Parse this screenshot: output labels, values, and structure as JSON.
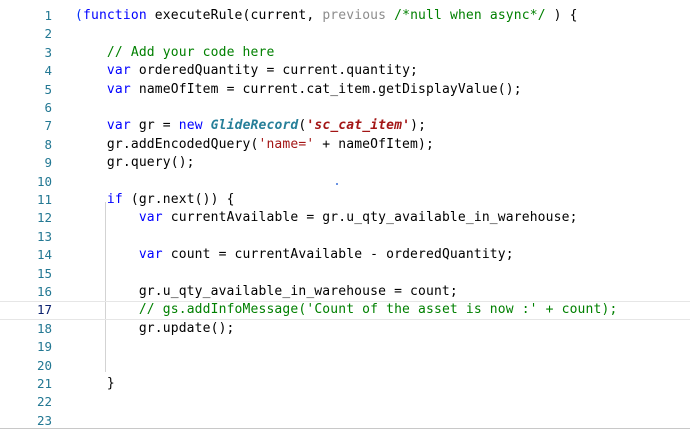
{
  "editor": {
    "active_line": 17,
    "line_numbers": [
      "1",
      "2",
      "3",
      "4",
      "5",
      "6",
      "7",
      "8",
      "9",
      "10",
      "11",
      "12",
      "13",
      "14",
      "15",
      "16",
      "17",
      "18",
      "19",
      "20",
      "21",
      "22",
      "23"
    ],
    "lines": [
      {
        "n": "1",
        "tokens": [
          {
            "t": "(",
            "c": "br1"
          },
          {
            "t": "function",
            "c": "kw"
          },
          {
            "t": " executeRule(current, "
          },
          {
            "t": "previous",
            "c": "prm"
          },
          {
            "t": " "
          },
          {
            "t": "/*null when async*/",
            "c": "cm"
          },
          {
            "t": " ) {"
          }
        ]
      },
      {
        "n": "2",
        "tokens": []
      },
      {
        "n": "3",
        "tokens": [
          {
            "t": "    "
          },
          {
            "t": "// Add your code here",
            "c": "cm"
          }
        ]
      },
      {
        "n": "4",
        "tokens": [
          {
            "t": "    "
          },
          {
            "t": "var",
            "c": "kw"
          },
          {
            "t": " orderedQuantity = current.quantity;"
          }
        ]
      },
      {
        "n": "5",
        "tokens": [
          {
            "t": "    "
          },
          {
            "t": "var",
            "c": "kw"
          },
          {
            "t": " nameOfItem = current.cat_item.getDisplayValue();"
          }
        ]
      },
      {
        "n": "6",
        "tokens": []
      },
      {
        "n": "7",
        "tokens": [
          {
            "t": "    "
          },
          {
            "t": "var",
            "c": "kw"
          },
          {
            "t": " gr = "
          },
          {
            "t": "new",
            "c": "kw"
          },
          {
            "t": " "
          },
          {
            "t": "GlideRecord",
            "c": "cls"
          },
          {
            "t": "("
          },
          {
            "t": "'sc_cat_item'",
            "c": "str-it"
          },
          {
            "t": ");"
          }
        ]
      },
      {
        "n": "8",
        "tokens": [
          {
            "t": "    gr.addEncodedQuery("
          },
          {
            "t": "'name='",
            "c": "str"
          },
          {
            "t": " + nameOfItem);"
          }
        ]
      },
      {
        "n": "9",
        "tokens": [
          {
            "t": "    gr.query();"
          }
        ]
      },
      {
        "n": "10",
        "tokens": []
      },
      {
        "n": "11",
        "tokens": [
          {
            "t": "    "
          },
          {
            "t": "if",
            "c": "kw"
          },
          {
            "t": " (gr.next()) {"
          }
        ]
      },
      {
        "n": "12",
        "tokens": [
          {
            "t": "        "
          },
          {
            "t": "var",
            "c": "kw"
          },
          {
            "t": " currentAvailable = gr.u_qty_available_in_warehouse;"
          }
        ]
      },
      {
        "n": "13",
        "tokens": []
      },
      {
        "n": "14",
        "tokens": [
          {
            "t": "        "
          },
          {
            "t": "var",
            "c": "kw"
          },
          {
            "t": " count = currentAvailable - orderedQuantity;"
          }
        ]
      },
      {
        "n": "15",
        "tokens": []
      },
      {
        "n": "16",
        "tokens": [
          {
            "t": "        gr.u_qty_available_in_warehouse = count;"
          }
        ]
      },
      {
        "n": "17",
        "tokens": [
          {
            "t": "        "
          },
          {
            "t": "// gs.addInfoMessage('Count of the asset is now :' + count);",
            "c": "cm"
          }
        ]
      },
      {
        "n": "18",
        "tokens": [
          {
            "t": "        gr.update();"
          }
        ]
      },
      {
        "n": "19",
        "tokens": []
      },
      {
        "n": "20",
        "tokens": []
      },
      {
        "n": "21",
        "tokens": [
          {
            "t": "    }"
          }
        ]
      },
      {
        "n": "22",
        "tokens": []
      },
      {
        "n": "23",
        "tokens": []
      }
    ]
  }
}
